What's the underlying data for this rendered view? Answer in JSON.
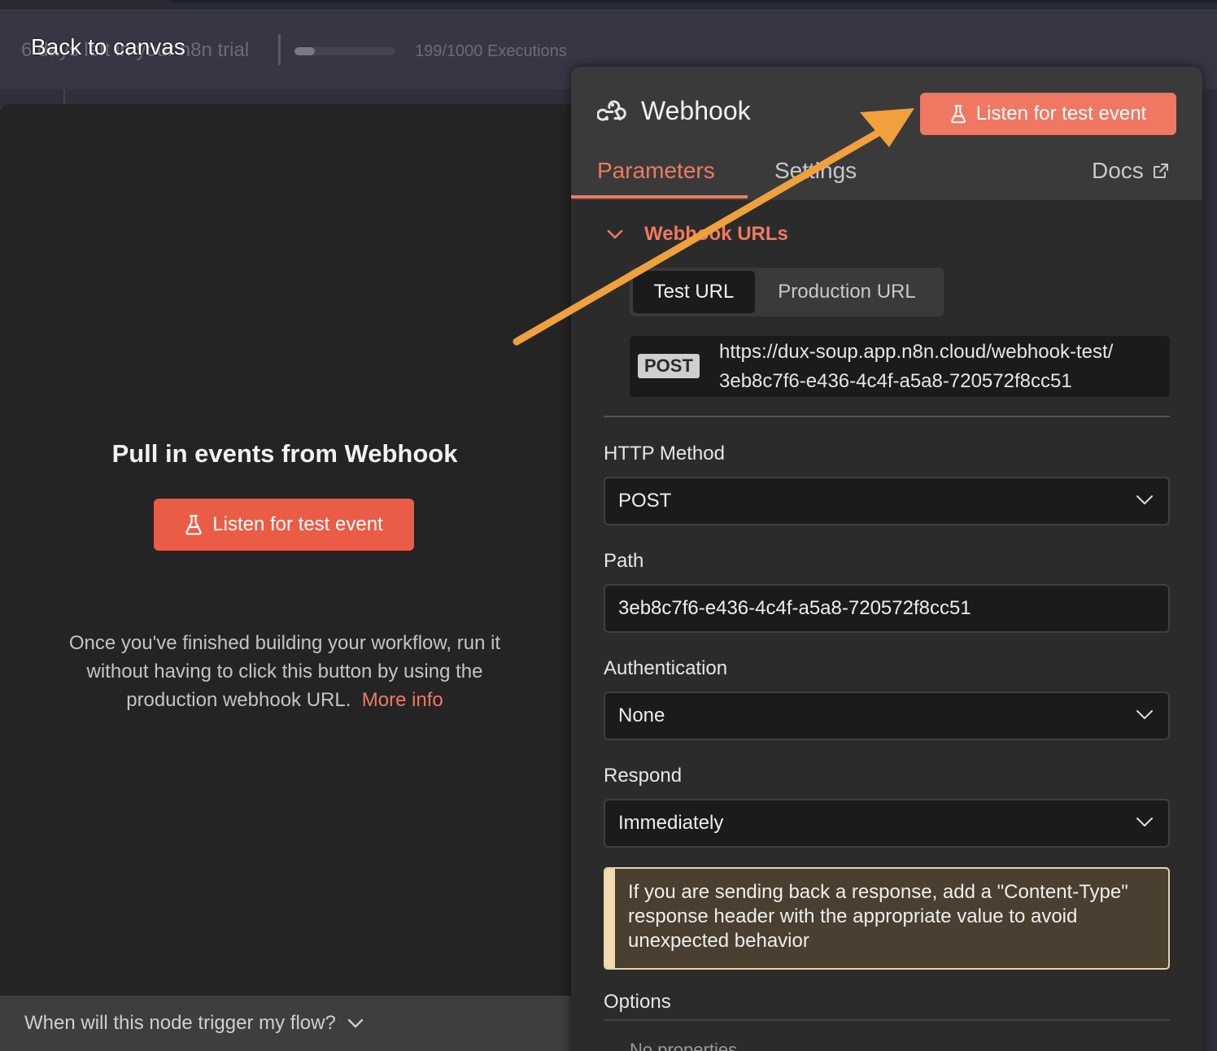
{
  "topbar": {
    "trial_text": "6 days left in your n8n trial",
    "back_label": "Back to canvas",
    "executions_text": "199/1000 Executions",
    "executions_fraction": 0.199
  },
  "input_panel": {
    "title": "Pull in events from Webhook",
    "listen_label": "Listen for test event",
    "description": "Once you've finished building your workflow, run it without having to click this button by using the production webhook URL.",
    "more_info": "More info",
    "footer_question": "When will this node trigger my flow?"
  },
  "node": {
    "title": "Webhook",
    "listen_label": "Listen for test event",
    "tabs": {
      "parameters": "Parameters",
      "settings": "Settings",
      "docs": "Docs"
    },
    "webhook_urls": {
      "heading": "Webhook URLs",
      "test_url_tab": "Test URL",
      "production_url_tab": "Production URL",
      "method": "POST",
      "url_line1": "https://dux-soup.app.n8n.cloud/webhook-test/",
      "url_line2": "3eb8c7f6-e436-4c4f-a5a8-720572f8cc51"
    },
    "fields": {
      "http_method_label": "HTTP Method",
      "http_method_value": "POST",
      "path_label": "Path",
      "path_value": "3eb8c7f6-e436-4c4f-a5a8-720572f8cc51",
      "auth_label": "Authentication",
      "auth_value": "None",
      "respond_label": "Respond",
      "respond_value": "Immediately"
    },
    "notice": "If you are sending back a response, add a \"Content-Type\" response header with the appropriate value to avoid unexpected behavior",
    "options_label": "Options",
    "no_properties": "No properties"
  },
  "colors": {
    "accent": "#ea5c45",
    "arrow": "#f0a03c"
  }
}
